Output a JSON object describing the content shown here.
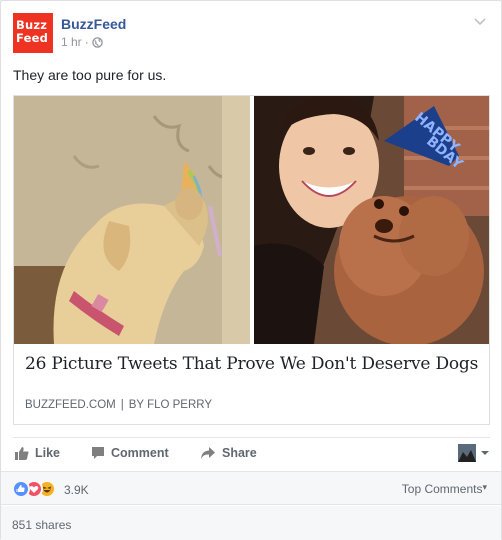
{
  "post": {
    "page_logo_line1": "Buzz",
    "page_logo_line2": "Feed",
    "page_name": "BuzzFeed",
    "time": "1 hr",
    "separator": "·",
    "text": "They are too pure for us."
  },
  "link": {
    "title": "26 Picture Tweets That Prove We Don't Deserve Dogs",
    "domain": "BUZZFEED.COM",
    "divider": "|",
    "byline": "BY FLO PERRY"
  },
  "actions": {
    "like": "Like",
    "comment": "Comment",
    "share": "Share"
  },
  "reactions": {
    "count": "3.9K",
    "top_comments": "Top Comments",
    "top_comments_caret": "▾",
    "icons": [
      "like-reaction-icon",
      "love-reaction-icon",
      "haha-reaction-icon"
    ]
  },
  "shares": {
    "label": "851 shares"
  },
  "colors": {
    "brand_red": "#ee3322",
    "link_blue": "#365899",
    "like_blue": "#5890ff",
    "love_red": "#f25268",
    "haha_yellow": "#f7b125"
  }
}
